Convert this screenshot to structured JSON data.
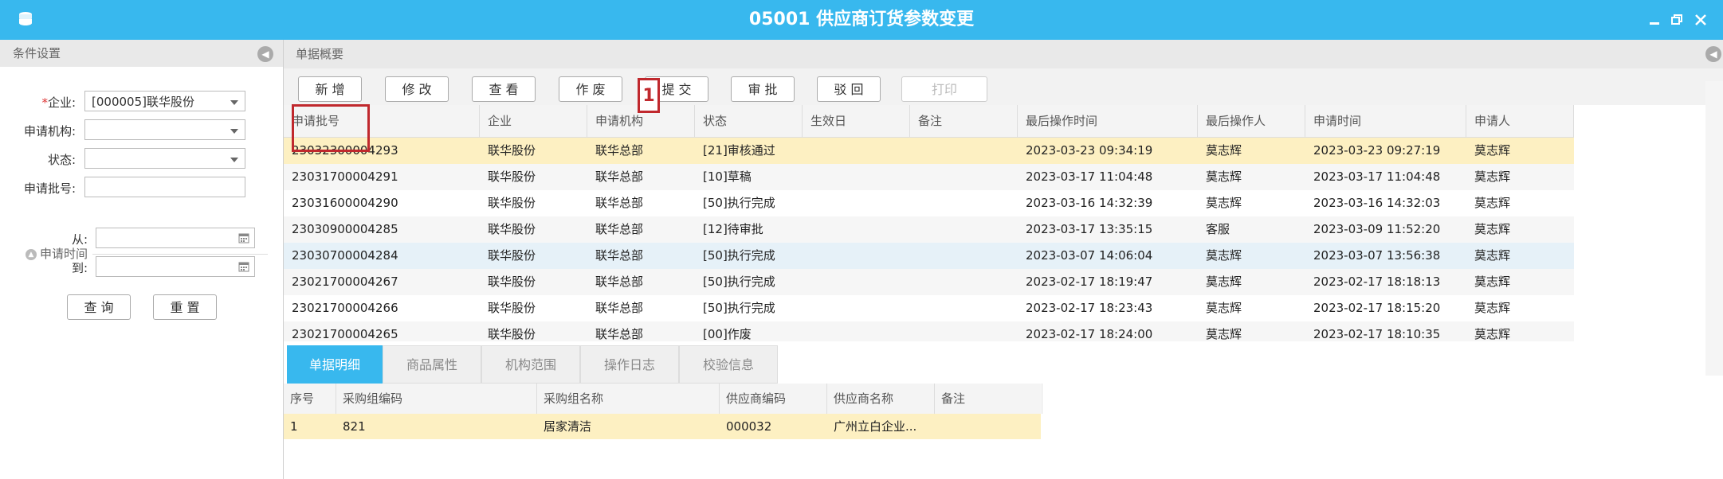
{
  "window": {
    "title": "05001 供应商订货参数变更",
    "colors": {
      "titlebar": "#38b8ee",
      "selected_row": "#fdf0c2",
      "callout": "#c0282d"
    }
  },
  "left_panel": {
    "header": "条件设置",
    "fields": {
      "company": {
        "label": "企业:",
        "required_mark": "*",
        "value": "[000005]联华股份"
      },
      "org": {
        "label": "申请机构:",
        "value": ""
      },
      "status": {
        "label": "状态:",
        "value": ""
      },
      "batch_no": {
        "label": "申请批号:",
        "value": ""
      }
    },
    "date_group": {
      "title": "申请时间",
      "from_label": "从:",
      "to_label": "到:",
      "from_value": "",
      "to_value": ""
    },
    "query_button": "查 询",
    "reset_button": "重 置"
  },
  "right_panel": {
    "header": "单据概要",
    "toolbar": [
      "新 增",
      "修 改",
      "查 看",
      "作 废",
      "提 交",
      "审 批",
      "驳 回",
      "打印"
    ],
    "callout_number": "1",
    "grid": {
      "columns": [
        "申请批号",
        "企业",
        "申请机构",
        "状态",
        "生效日",
        "备注",
        "最后操作时间",
        "最后操作人",
        "申请时间",
        "申请人"
      ],
      "rows": [
        [
          "23032300004293",
          "联华股份",
          "联华总部",
          "[21]审核通过",
          "",
          "",
          "2023-03-23 09:34:19",
          "莫志辉",
          "2023-03-23 09:27:19",
          "莫志辉"
        ],
        [
          "23031700004291",
          "联华股份",
          "联华总部",
          "[10]草稿",
          "",
          "",
          "2023-03-17 11:04:48",
          "莫志辉",
          "2023-03-17 11:04:48",
          "莫志辉"
        ],
        [
          "23031600004290",
          "联华股份",
          "联华总部",
          "[50]执行完成",
          "",
          "",
          "2023-03-16 14:32:39",
          "莫志辉",
          "2023-03-16 14:32:03",
          "莫志辉"
        ],
        [
          "23030900004285",
          "联华股份",
          "联华总部",
          "[12]待审批",
          "",
          "",
          "2023-03-17 13:35:15",
          "客服",
          "2023-03-09 11:52:20",
          "莫志辉"
        ],
        [
          "23030700004284",
          "联华股份",
          "联华总部",
          "[50]执行完成",
          "",
          "",
          "2023-03-07 14:06:04",
          "莫志辉",
          "2023-03-07 13:56:38",
          "莫志辉"
        ],
        [
          "23021700004267",
          "联华股份",
          "联华总部",
          "[50]执行完成",
          "",
          "",
          "2023-02-17 18:19:47",
          "莫志辉",
          "2023-02-17 18:18:13",
          "莫志辉"
        ],
        [
          "23021700004266",
          "联华股份",
          "联华总部",
          "[50]执行完成",
          "",
          "",
          "2023-02-17 18:23:43",
          "莫志辉",
          "2023-02-17 18:15:20",
          "莫志辉"
        ],
        [
          "23021700004265",
          "联华股份",
          "联华总部",
          "[00]作废",
          "",
          "",
          "2023-02-17 18:24:00",
          "莫志辉",
          "2023-02-17 18:10:35",
          "莫志辉"
        ]
      ]
    },
    "tabs": [
      "单据明细",
      "商品属性",
      "机构范围",
      "操作日志",
      "校验信息"
    ],
    "detail": {
      "columns": [
        "序号",
        "采购组编码",
        "采购组名称",
        "供应商编码",
        "供应商名称",
        "备注"
      ],
      "rows": [
        [
          "1",
          "821",
          "居家清洁",
          "000032",
          "广州立白企业...",
          ""
        ]
      ]
    }
  }
}
